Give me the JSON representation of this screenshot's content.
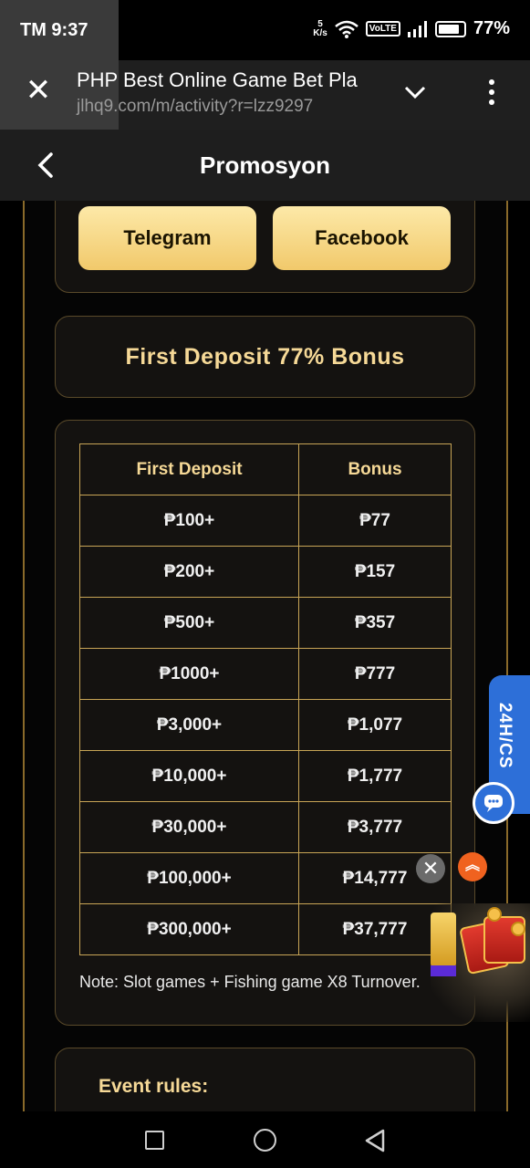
{
  "status_bar": {
    "carrier_time": "TM 9:37",
    "net_speed_value": "5",
    "net_speed_unit": "K/s",
    "volte": "VoLTE",
    "battery": "77%"
  },
  "browser": {
    "title": "PHP Best Online Game Bet Pla",
    "url": "jlhq9.com/m/activity?r=lzz9297"
  },
  "header": {
    "title": "Promosyon"
  },
  "share": {
    "telegram_label": "Telegram",
    "facebook_label": "Facebook"
  },
  "promo": {
    "title": "First Deposit 77% Bonus"
  },
  "table": {
    "headers": [
      "First Deposit",
      "Bonus"
    ],
    "rows": [
      [
        "₱100+",
        "₱77"
      ],
      [
        "₱200+",
        "₱157"
      ],
      [
        "₱500+",
        "₱357"
      ],
      [
        "₱1000+",
        "₱777"
      ],
      [
        "₱3,000+",
        "₱1,077"
      ],
      [
        "₱10,000+",
        "₱1,777"
      ],
      [
        "₱30,000+",
        "₱3,777"
      ],
      [
        "₱100,000+",
        "₱14,777"
      ],
      [
        "₱300,000+",
        "₱37,777"
      ]
    ],
    "note": "Note: Slot games + Fishing game X8 Turnover."
  },
  "rules": {
    "title": "Event rules:"
  },
  "support": {
    "label": "24H/CS"
  },
  "floating": {
    "dismiss_symbol": "✕",
    "scroll_top_symbol": "︽"
  },
  "colors": {
    "gold_text": "#f6d997",
    "button_gold": "#f1c96b",
    "support_blue": "#2d6fd8",
    "scroll_orange": "#f0621f"
  }
}
